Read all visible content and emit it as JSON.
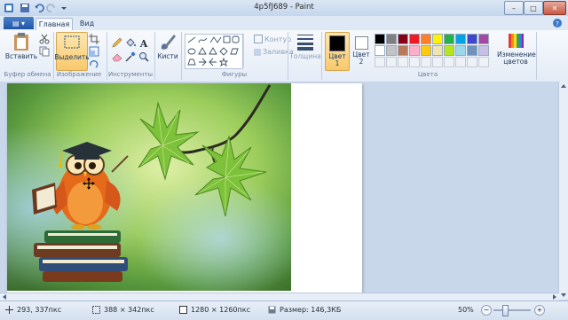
{
  "window": {
    "title": "4p5fJ689 - Paint",
    "minimize": "–",
    "maximize": "□",
    "close": "✕"
  },
  "tabs": {
    "file": "▤ ▾",
    "home": "Главная",
    "view": "Вид"
  },
  "ribbon": {
    "clipboard": {
      "paste": "Вставить",
      "group": "Буфер обмена"
    },
    "image": {
      "select": "Выделить",
      "group": "Изображение"
    },
    "tools": {
      "group": "Инструменты",
      "text_tool": "A"
    },
    "brushes": {
      "label": "Кисти"
    },
    "shapes": {
      "outline": "Контур",
      "fill": "Заливка",
      "group": "Фигуры"
    },
    "size": {
      "label": "Толщина"
    },
    "colors": {
      "color1": "Цвет 1",
      "color2": "Цвет 2",
      "edit": "Изменение цветов",
      "group": "Цвета",
      "color1_value": "#000000",
      "color2_value": "#ffffff",
      "palette_row1": [
        "#000000",
        "#7f7f7f",
        "#880015",
        "#ed1c24",
        "#ff7f27",
        "#fff200",
        "#22b14c",
        "#00a2e8",
        "#3f48cc",
        "#a349a4"
      ],
      "palette_row2": [
        "#ffffff",
        "#c3c3c3",
        "#b97a57",
        "#ffaec9",
        "#ffc90e",
        "#efe4b0",
        "#b5e61d",
        "#99d9ea",
        "#7092be",
        "#c8bfe7"
      ]
    }
  },
  "status": {
    "cursor": "293, 337пкс",
    "selection": "388 × 342пкс",
    "image_size": "1280 × 1260пкс",
    "file_size": "Размер: 146,3КБ",
    "zoom": "50%",
    "zoom_out": "−",
    "zoom_in": "+"
  }
}
